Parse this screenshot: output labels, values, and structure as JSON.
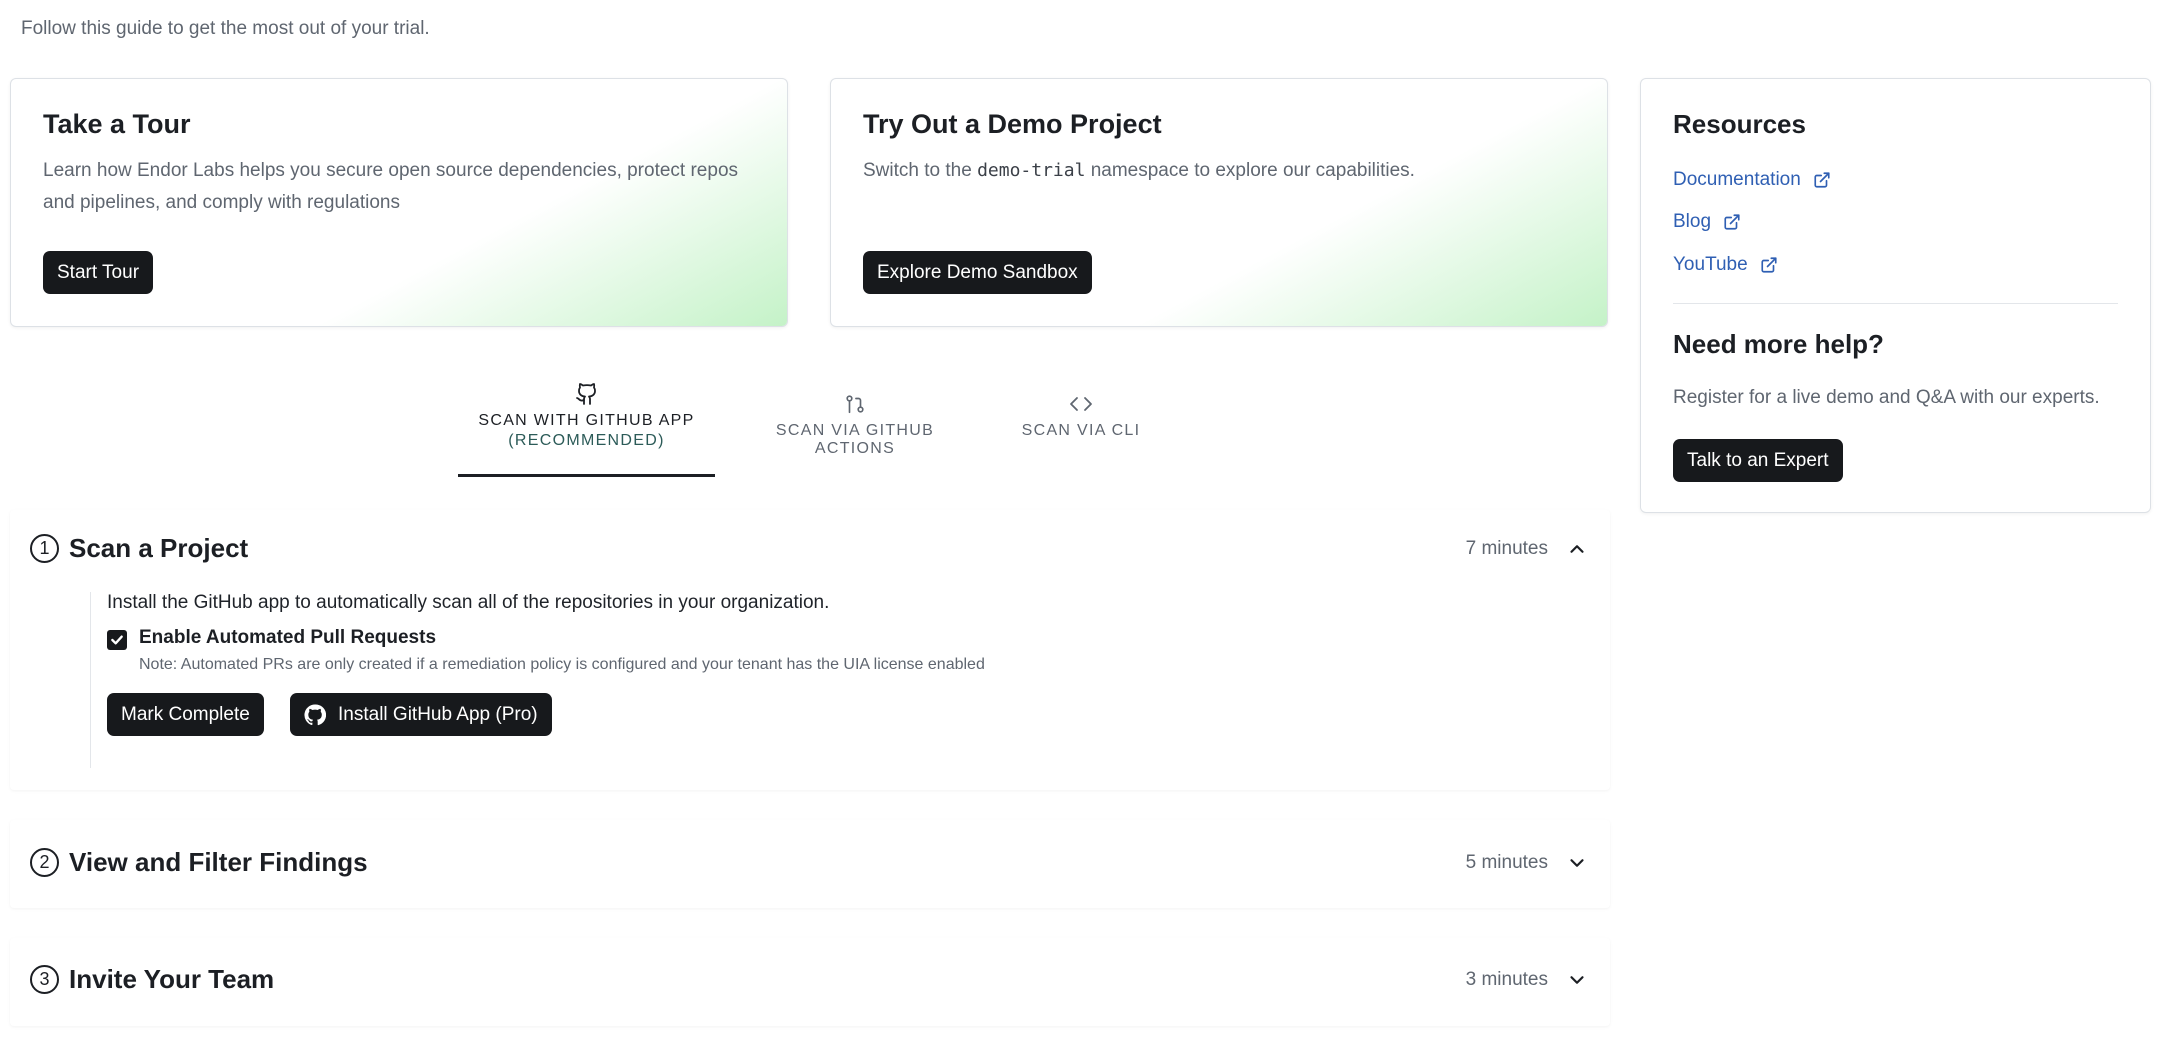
{
  "intro": "Follow this guide to get the most out of your trial.",
  "tour_card": {
    "title": "Take a Tour",
    "description": "Learn how Endor Labs helps you secure open source dependencies, protect repos and pipelines, and comply with regulations",
    "button": "Start Tour"
  },
  "demo_card": {
    "title": "Try Out a Demo Project",
    "desc_before": "Switch to the ",
    "desc_code": "demo-trial",
    "desc_after": " namespace to explore our capabilities.",
    "button": "Explore Demo Sandbox"
  },
  "resources": {
    "title": "Resources",
    "links": [
      {
        "label": "Documentation",
        "icon": "external-link-icon"
      },
      {
        "label": "Blog",
        "icon": "external-link-icon"
      },
      {
        "label": "YouTube",
        "icon": "external-link-icon"
      }
    ],
    "help_title": "Need more help?",
    "help_desc": "Register for a live demo and Q&A with our experts.",
    "help_button": "Talk to an Expert"
  },
  "tabs": [
    {
      "label": "SCAN WITH GITHUB APP",
      "sub": "(RECOMMENDED)",
      "icon": "github-icon",
      "active": true
    },
    {
      "label": "SCAN VIA GITHUB ACTIONS",
      "icon": "git-pull-request-icon",
      "active": false
    },
    {
      "label": "SCAN VIA CLI",
      "icon": "code-icon",
      "active": false
    }
  ],
  "steps": [
    {
      "number": "1",
      "title": "Scan a Project",
      "time": "7 minutes",
      "expanded": true,
      "body": "Install the GitHub app to automatically scan all of the repositories in your organization.",
      "checkbox_label": "Enable Automated Pull Requests",
      "checkbox_checked": true,
      "note": "Note: Automated PRs are only created if a remediation policy is configured and your tenant has the UIA license enabled",
      "mark_complete": "Mark Complete",
      "install_button": "Install GitHub App (Pro)"
    },
    {
      "number": "2",
      "title": "View and Filter Findings",
      "time": "5 minutes",
      "expanded": false
    },
    {
      "number": "3",
      "title": "Invite Your Team",
      "time": "3 minutes",
      "expanded": false
    }
  ],
  "colors": {
    "primary_button": "#17191c",
    "link": "#2f5fb3",
    "accent_gradient": "#baf0be"
  }
}
